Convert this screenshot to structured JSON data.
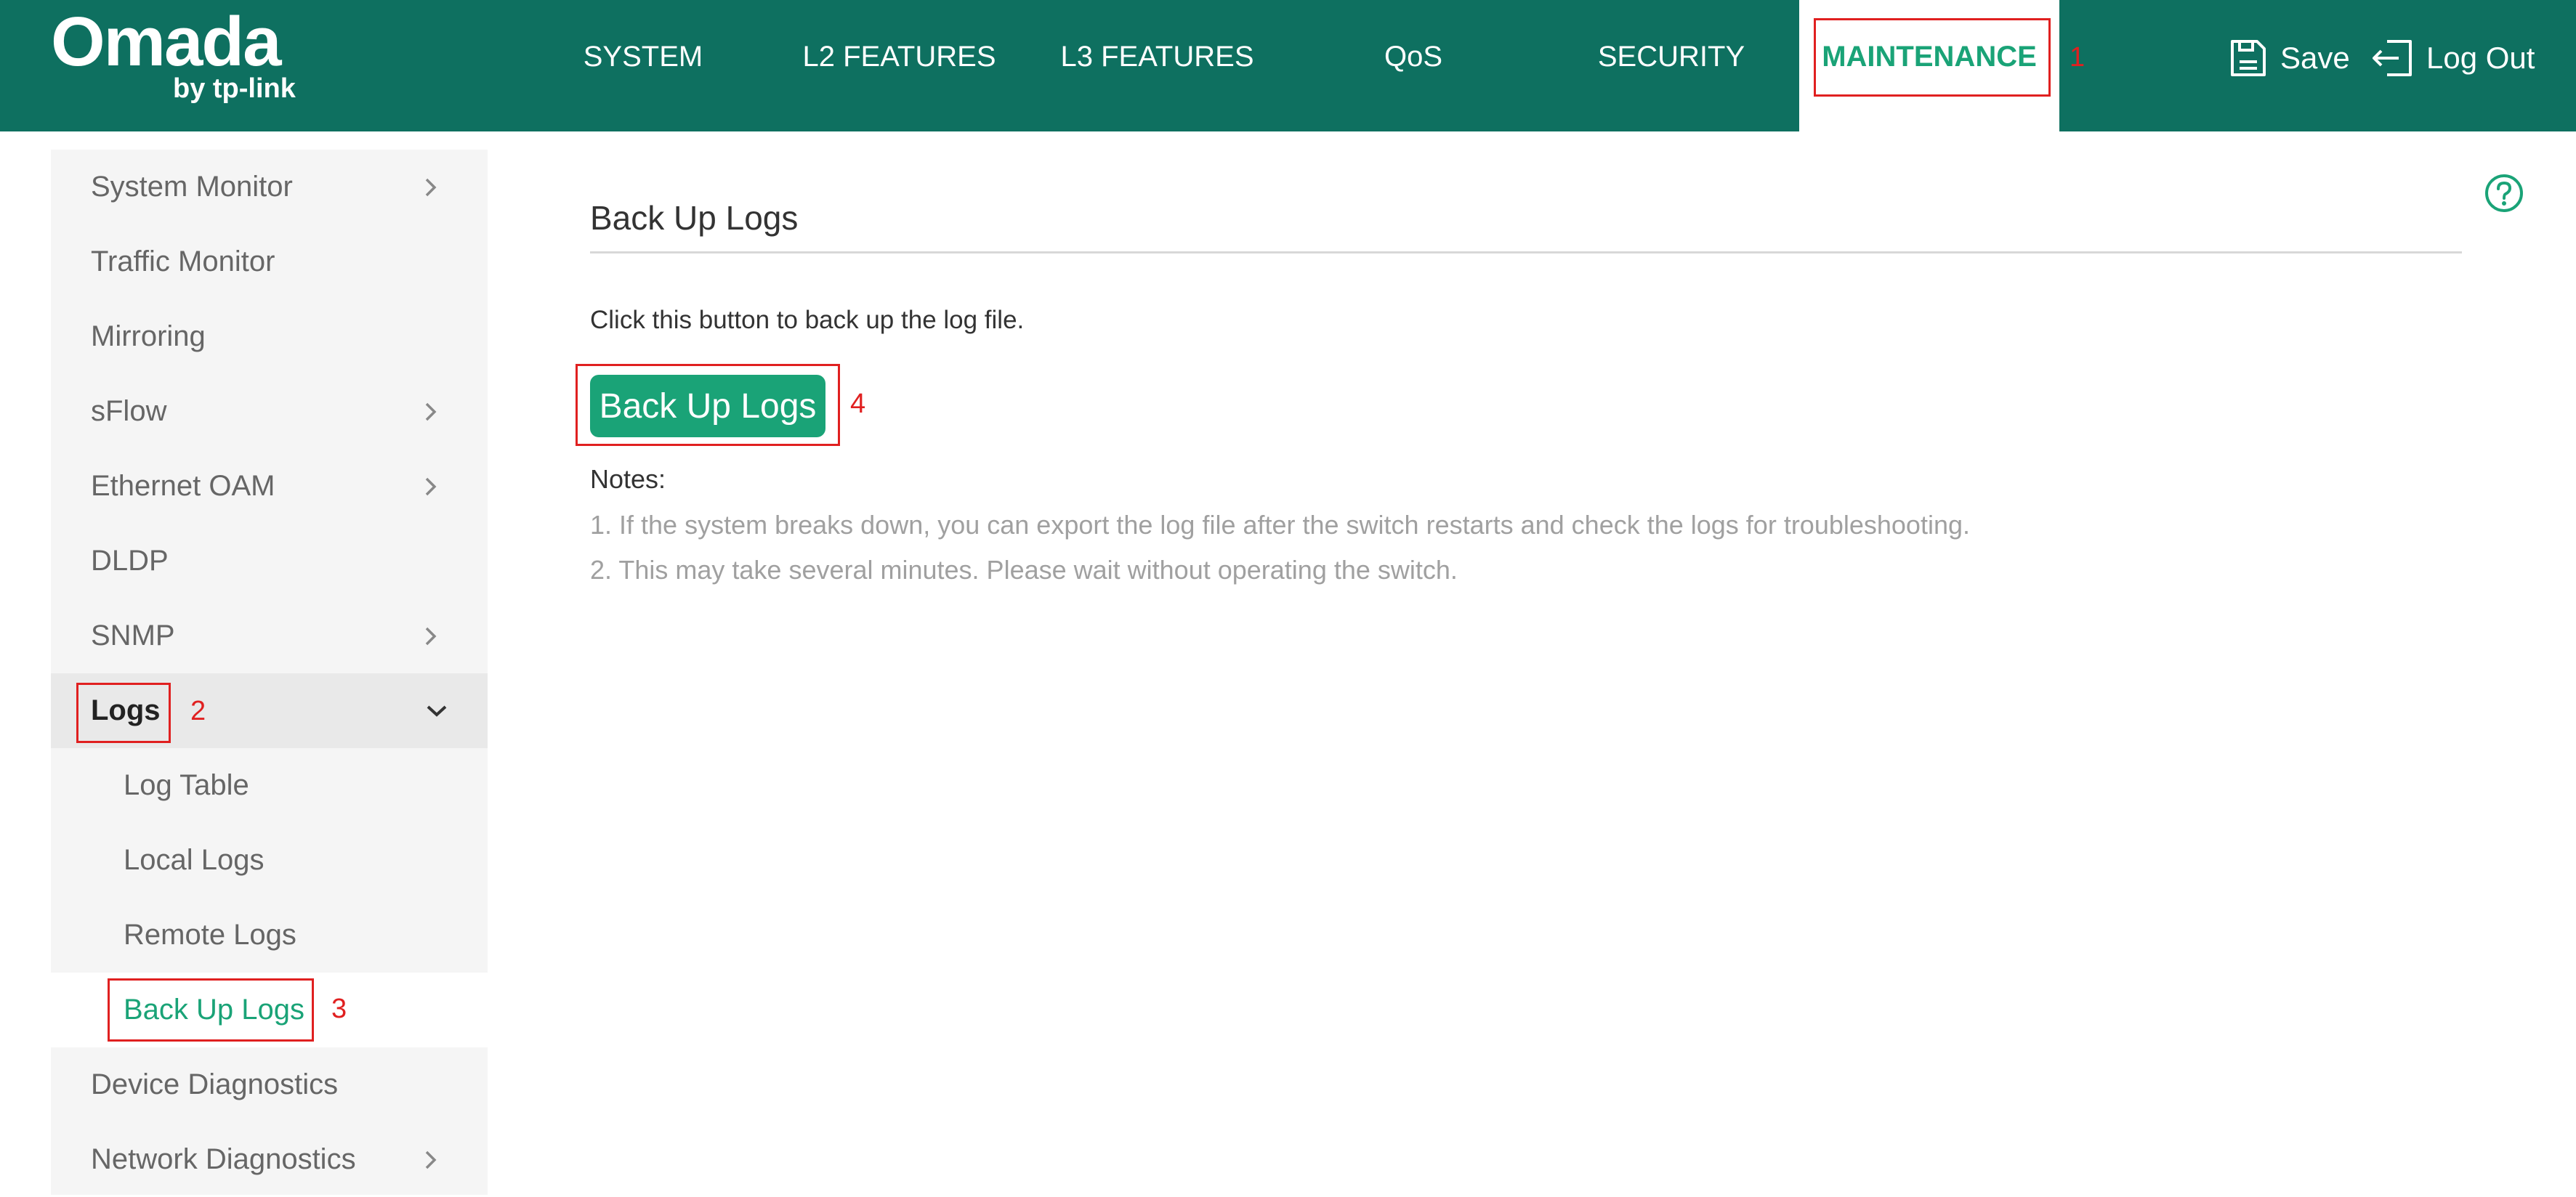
{
  "header": {
    "logo_text": "Omada",
    "logo_sub": "by tp-link",
    "nav": [
      "SYSTEM",
      "L2 FEATURES",
      "L3 FEATURES",
      "QoS",
      "SECURITY",
      "MAINTENANCE"
    ],
    "active_nav": "MAINTENANCE",
    "save_label": "Save",
    "logout_label": "Log Out"
  },
  "sidebar": {
    "items": [
      {
        "label": "System Monitor",
        "chevron": "right"
      },
      {
        "label": "Traffic Monitor"
      },
      {
        "label": "Mirroring"
      },
      {
        "label": "sFlow",
        "chevron": "right"
      },
      {
        "label": "Ethernet OAM",
        "chevron": "right"
      },
      {
        "label": "DLDP"
      },
      {
        "label": "SNMP",
        "chevron": "right"
      },
      {
        "label": "Logs",
        "chevron": "down",
        "expanded": true
      },
      {
        "label": "Log Table",
        "sub": true
      },
      {
        "label": "Local Logs",
        "sub": true
      },
      {
        "label": "Remote Logs",
        "sub": true
      },
      {
        "label": "Back Up Logs",
        "sub": true,
        "selected": true
      },
      {
        "label": "Device Diagnostics"
      },
      {
        "label": "Network Diagnostics",
        "chevron": "right"
      }
    ]
  },
  "main": {
    "title": "Back Up Logs",
    "description": "Click this button to back up the log file.",
    "button_label": "Back Up Logs",
    "notes_title": "Notes:",
    "notes": [
      "1. If the system breaks down, you can export the log file after the switch restarts and check the logs for troubleshooting.",
      "2. This may take several minutes. Please wait without operating the switch."
    ]
  },
  "annotations": [
    "1",
    "2",
    "3",
    "4"
  ],
  "colors": {
    "header_bg": "#0e7060",
    "accent_green": "#1aa377",
    "annotation_red": "#e02020"
  }
}
